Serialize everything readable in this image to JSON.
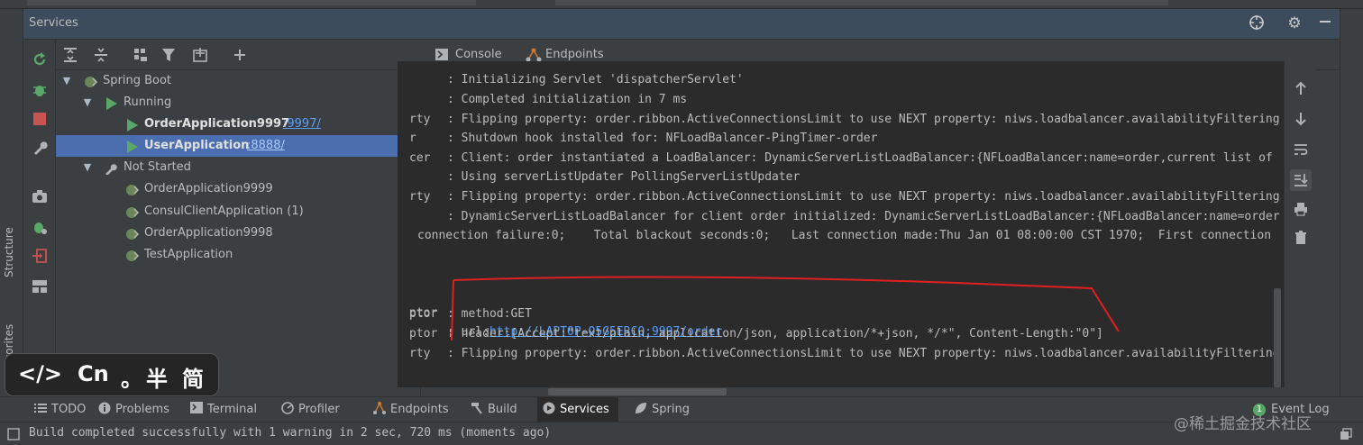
{
  "panel": {
    "title": "Services"
  },
  "tree": {
    "root": "Spring Boot",
    "running_group": "Running",
    "running": [
      {
        "name": "OrderApplication9997",
        "port": ":9997/"
      },
      {
        "name": "UserApplication",
        "port": ":8888/"
      }
    ],
    "not_started_group": "Not Started",
    "not_started": [
      "OrderApplication9999",
      "ConsulClientApplication (1)",
      "OrderApplication9998",
      "TestApplication"
    ]
  },
  "console_tabs": {
    "console": "Console",
    "endpoints": "Endpoints"
  },
  "console_lines": [
    {
      "prefix": "",
      "text": ": Initializing Servlet 'dispatcherServlet'"
    },
    {
      "prefix": "",
      "text": ": Completed initialization in 7 ms"
    },
    {
      "prefix": "rty",
      "text": ": Flipping property: order.ribbon.ActiveConnectionsLimit to use NEXT property: niws.loadbalancer.availabilityFiltering"
    },
    {
      "prefix": "r",
      "text": ": Shutdown hook installed for: NFLoadBalancer-PingTimer-order"
    },
    {
      "prefix": "cer",
      "text": ": Client: order instantiated a LoadBalancer: DynamicServerListLoadBalancer:{NFLoadBalancer:name=order,current list of"
    },
    {
      "prefix": "",
      "text": ": Using serverListUpdater PollingServerListUpdater"
    },
    {
      "prefix": "rty",
      "text": ": Flipping property: order.ribbon.ActiveConnectionsLimit to use NEXT property: niws.loadbalancer.availabilityFiltering"
    },
    {
      "prefix": "",
      "text": ": DynamicServerListLoadBalancer for client order initialized: DynamicServerListLoadBalancer:{NFLoadBalancer:name=order"
    },
    {
      "prefix": "",
      "text": "connection failure:0;    Total blackout seconds:0;   Last connection made:Thu Jan 01 08:00:00 CST 1970;  First connection"
    }
  ],
  "request_lines": {
    "prefix": "ptor",
    "url_label": ": url:",
    "url": "http://LAPTOP-Q5G5ERCQ:9997/order",
    "method": ": method:GET",
    "header": ": header:[Accept:\"text/plain, application/json, application/*+json, */*\", Content-Length:\"0\"]",
    "last_prefix": "rty",
    "last": ": Flipping property: order.ribbon.ActiveConnectionsLimit to use NEXT property: niws.loadbalancer.availabilityFiltering"
  },
  "bottom_tabs": [
    "TODO",
    "Problems",
    "Terminal",
    "Profiler",
    "Endpoints",
    "Build",
    "Services",
    "Spring"
  ],
  "event_log": {
    "label": "Event Log",
    "count": "1"
  },
  "status": "Build completed successfully with 1 warning in 2 sec, 720 ms (moments ago)",
  "side_tabs": {
    "structure": "Structure",
    "favorites": "Favorites"
  },
  "ime": {
    "code": "</>",
    "lang": "Cn",
    "dot": "。",
    "half": "半",
    "simp": "简"
  },
  "watermark": "@稀土掘金技术社区",
  "colors": {
    "accent": "#4a88c7",
    "selection": "#4b6eaf",
    "link": "#589df6",
    "run_green": "#59a869",
    "stop_red": "#c75450",
    "annotation": "#e02020"
  }
}
